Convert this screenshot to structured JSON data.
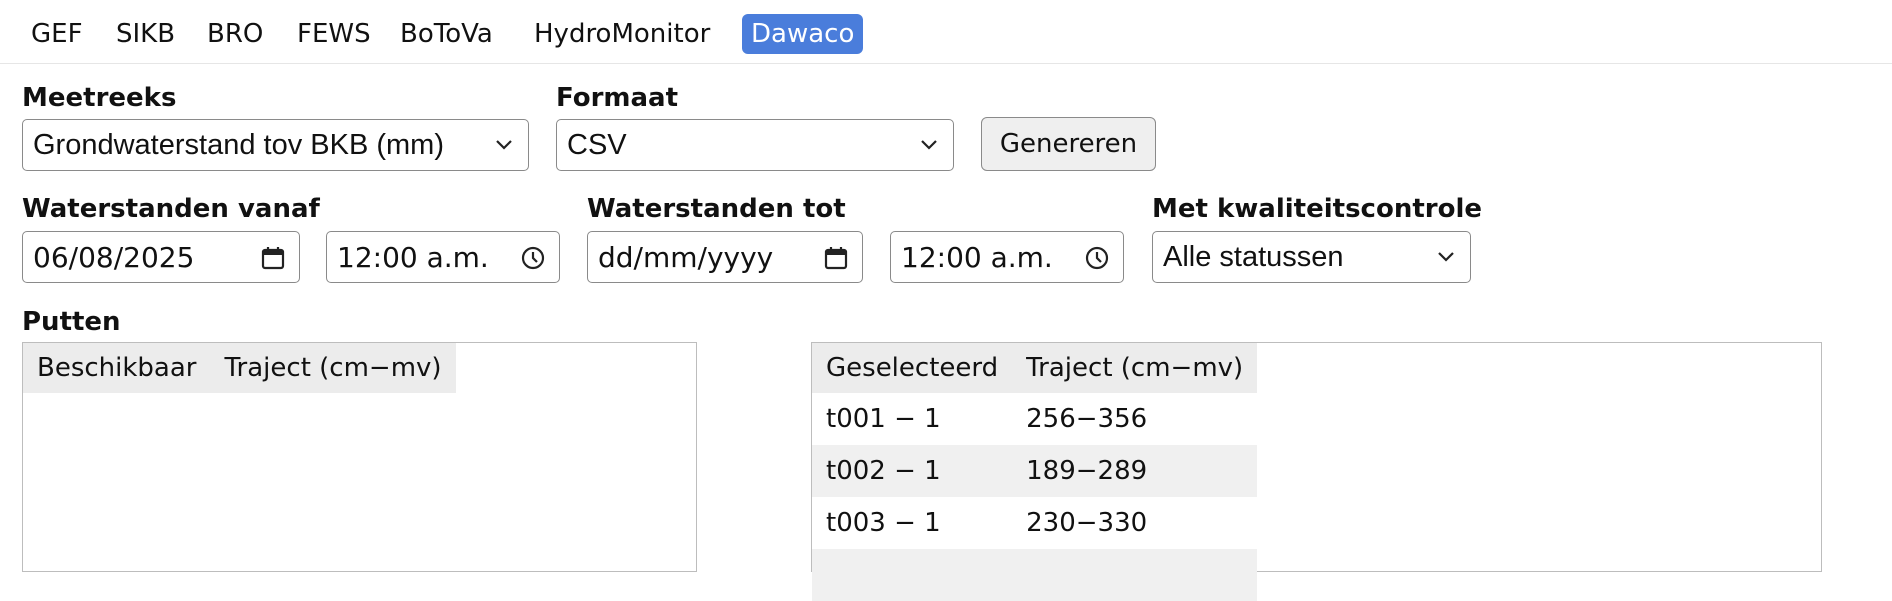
{
  "tabs": [
    {
      "label": "GEF"
    },
    {
      "label": "SIKB"
    },
    {
      "label": "BRO"
    },
    {
      "label": "FEWS"
    },
    {
      "label": "BoToVa"
    },
    {
      "label": "HydroMonitor"
    },
    {
      "label": "Dawaco",
      "active": true
    }
  ],
  "form": {
    "meetreeks_label": "Meetreeks",
    "meetreeks_value": "Grondwaterstand tov BKB (mm)",
    "formaat_label": "Formaat",
    "formaat_value": "CSV",
    "generate_label": "Genereren",
    "vanaf_label": "Waterstanden vanaf",
    "vanaf_date": "06/08/2025",
    "vanaf_time": "12:00 a.m.",
    "tot_label": "Waterstanden tot",
    "tot_date_placeholder": "dd/mm/yyyy",
    "tot_time": "12:00 a.m.",
    "kwaliteit_label": "Met kwaliteitscontrole",
    "kwaliteit_value": "Alle statussen"
  },
  "putten": {
    "title": "Putten",
    "available": {
      "headers": [
        "Beschikbaar",
        "Traject (cm−mv)"
      ],
      "rows": []
    },
    "selected": {
      "headers": [
        "Geselecteerd",
        "Traject (cm−mv)"
      ],
      "rows": [
        [
          "t001 − 1",
          "256−356"
        ],
        [
          "t002 − 1",
          "189−289"
        ],
        [
          "t003 − 1",
          "230−330"
        ]
      ]
    }
  },
  "icons": {
    "dropdown": "chevron-down-icon",
    "date": "calendar-icon",
    "time": "clock-icon"
  },
  "colors": {
    "active_tab": "#4a7ddb",
    "header_bg": "#ececec",
    "alt_row_bg": "#f0f0f0"
  }
}
